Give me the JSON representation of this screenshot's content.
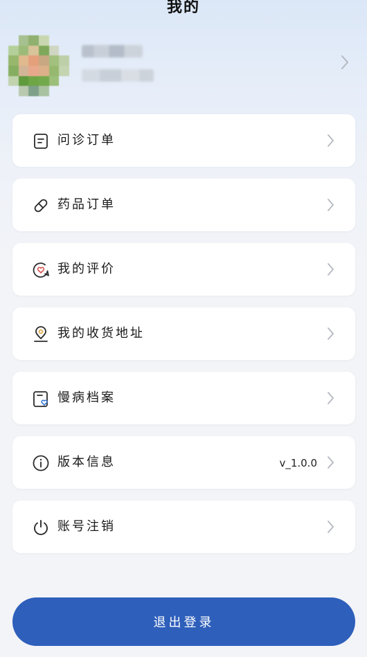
{
  "header": {
    "title": "我的"
  },
  "profile": {
    "name": "",
    "subtitle": "",
    "chevron_icon": "chevron-right-icon"
  },
  "menu": {
    "items": [
      {
        "label": "问诊订单",
        "icon": "document-icon",
        "value": ""
      },
      {
        "label": "药品订单",
        "icon": "pill-icon",
        "value": ""
      },
      {
        "label": "我的评价",
        "icon": "heart-message-icon",
        "value": ""
      },
      {
        "label": "我的收货地址",
        "icon": "location-pin-icon",
        "value": ""
      },
      {
        "label": "慢病档案",
        "icon": "file-heart-icon",
        "value": ""
      },
      {
        "label": "版本信息",
        "icon": "info-icon",
        "value": "v_1.0.0"
      },
      {
        "label": "账号注销",
        "icon": "power-icon",
        "value": ""
      }
    ]
  },
  "logout": {
    "label": "退出登录"
  },
  "colors": {
    "primary": "#2e5fbb",
    "card": "#ffffff",
    "background": "#f3f4f7",
    "chevron": "#b5b9c0"
  }
}
